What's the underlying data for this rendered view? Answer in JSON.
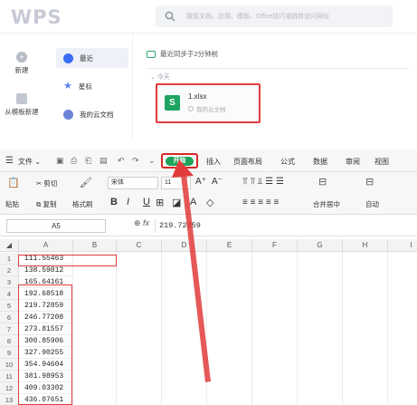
{
  "home": {
    "logo": "WPS",
    "search_placeholder": "搜索文档、应用、模板、Office技巧或跳转访问网址",
    "left_nav": [
      {
        "label": "新建",
        "icon": "plus-icon"
      },
      {
        "label": "从模板新建",
        "icon": "template-icon"
      }
    ],
    "sub_nav": [
      {
        "label": "最近",
        "icon": "recent-icon",
        "active": true
      },
      {
        "label": "星标",
        "icon": "star-icon",
        "active": false
      },
      {
        "label": "我的云文档",
        "icon": "cloud-icon",
        "active": false
      }
    ],
    "sync_status": "最近同步于2分钟前",
    "group_label": "今天",
    "file": {
      "icon_letter": "S",
      "name": "1.xlsx",
      "location": "我的云文档"
    }
  },
  "sheet": {
    "menu": {
      "hamburger": "☰",
      "file": "文件",
      "start": "开始",
      "tabs": [
        "插入",
        "页面布局",
        "公式",
        "数据",
        "审阅",
        "视图"
      ]
    },
    "ribbon": {
      "paste": "粘贴",
      "cut": "剪切",
      "copy": "复制",
      "format_painter": "格式刷",
      "font_name": "宋体",
      "font_size": "11",
      "merge_center": "合并居中",
      "auto": "自动"
    },
    "name_box": "A5",
    "formula_value": "219.72859",
    "columns": [
      "A",
      "B",
      "C",
      "D",
      "E",
      "F",
      "G",
      "H",
      "I"
    ],
    "rows": [
      {
        "n": "1",
        "a": "111.55463"
      },
      {
        "n": "2",
        "a": "138.59812"
      },
      {
        "n": "3",
        "a": "165.64161"
      },
      {
        "n": "4",
        "a": "192.68518"
      },
      {
        "n": "5",
        "a": "219.72859"
      },
      {
        "n": "6",
        "a": "246.77208"
      },
      {
        "n": "7",
        "a": "273.81557"
      },
      {
        "n": "8",
        "a": "300.85906"
      },
      {
        "n": "9",
        "a": "327.90255"
      },
      {
        "n": "10",
        "a": "354.94604"
      },
      {
        "n": "11",
        "a": "381.98953"
      },
      {
        "n": "12",
        "a": "409.03302"
      },
      {
        "n": "13",
        "a": "436.07651"
      }
    ]
  },
  "annotation_color": "#e23b3b",
  "accent_green": "#1fa35b"
}
